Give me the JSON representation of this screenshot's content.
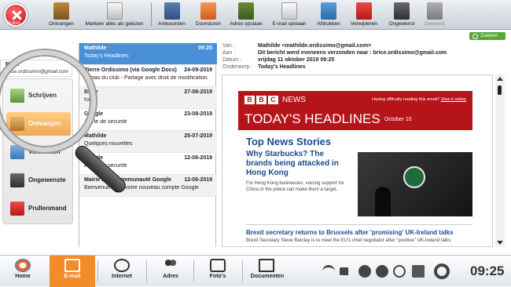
{
  "toolbar": {
    "close_label": "Sluiten",
    "items": [
      {
        "label": "Ontvangen",
        "icon": "inbox-icon"
      },
      {
        "label": "Markeer alles als gelezen",
        "icon": "mark-read-icon"
      },
      {
        "label": "Antwoorden",
        "icon": "reply-icon"
      },
      {
        "label": "Doorsturen",
        "icon": "forward-icon"
      },
      {
        "label": "Adres opslaan",
        "icon": "address-book-icon"
      },
      {
        "label": "E-mail opslaan",
        "icon": "save-mail-icon"
      },
      {
        "label": "Afdrukken",
        "icon": "print-icon"
      },
      {
        "label": "Verwijderen",
        "icon": "trash-icon"
      },
      {
        "label": "Ongewenst",
        "icon": "junk-icon"
      },
      {
        "label": "Gewenst",
        "icon": "wanted-icon"
      }
    ]
  },
  "search": {
    "button_label": "Zoeken"
  },
  "user": {
    "name": "Brice",
    "email": "brice.ordissimo@gmail.com"
  },
  "sidebar": {
    "items": [
      {
        "label": "Schrijven",
        "icon": "write-icon"
      },
      {
        "label": "Ontvangen",
        "icon": "inbox-icon",
        "active": true
      },
      {
        "label": "Verzonden",
        "icon": "sent-icon"
      },
      {
        "label": "Ongewenste",
        "icon": "junk-icon"
      },
      {
        "label": "Prullenmand",
        "icon": "trash-icon"
      }
    ]
  },
  "messages": [
    {
      "sender": "Mathilde",
      "date": "09:25",
      "subject": "Today's Headlines"
    },
    {
      "sender": "Pierre Ordissimo (via Google Docs)",
      "date": "24-09-2019",
      "subject": "Repas du club - Partage avec droit de modification"
    },
    {
      "sender": "Brice",
      "date": "27-08-2019",
      "subject": "foto"
    },
    {
      "sender": "Google",
      "date": "23-08-2019",
      "subject": "Alerte de sécurité"
    },
    {
      "sender": "Mathilde",
      "date": "25-07-2019",
      "subject": "Quelques nouvelles"
    },
    {
      "sender": "Google",
      "date": "12-06-2019",
      "subject": "Alerte de sécurité"
    },
    {
      "sender": "Mairie de la Communauté Google",
      "date": "12-06-2019",
      "subject": "Bienvenue dans votre nouveau compte Google"
    }
  ],
  "header": {
    "from_key": "Van :",
    "from_val": "Mathilde <mathilde.ordissimo@gmail.com>",
    "to_key": "Aan :",
    "to_val": "Dit bericht werd eveneens verzonden naar : brice.ordissimo@gmail.com",
    "date_key": "Datum :",
    "date_val": "vrijdag 11 oktober 2019 09:25",
    "subject_key": "Onderwerp :",
    "subject_val": "Today's Headlines"
  },
  "preview": {
    "bbc_letters": [
      "B",
      "B",
      "C"
    ],
    "bbc_news": "NEWS",
    "bbc_note": "Having difficulty reading this email?",
    "bbc_note_link": "View it online",
    "headline": "TODAY'S HEADLINES",
    "headline_date": "October 10",
    "section_title": "Top News Stories",
    "story_title": "Why Starbucks? The brands being attacked in Hong Kong",
    "story_text": "For Hong Kong businesses, voicing support for China or the police can make them a target.",
    "brexit_title": "Brexit secretary returns to Brussels after 'promising' UK-Ireland talks",
    "brexit_text": "Brexit Secretary Steve Barclay is to meet the EU's chief negotiator after \"positive\" UK-Ireland talks."
  },
  "taskbar": {
    "items": [
      {
        "label": "Home",
        "icon": "home-icon"
      },
      {
        "label": "E-mail",
        "icon": "email-icon",
        "active": true
      },
      {
        "label": "Internet",
        "icon": "globe-icon"
      },
      {
        "label": "Adres",
        "icon": "contacts-icon"
      },
      {
        "label": "Foto's",
        "icon": "camera-icon"
      },
      {
        "label": "Documenten",
        "icon": "documents-icon"
      }
    ],
    "clock": "09:25"
  },
  "colors": {
    "accent": "#f28c28",
    "selection": "#4a90d9",
    "bbc_red": "#b5141b",
    "link": "#1a4a8c"
  }
}
